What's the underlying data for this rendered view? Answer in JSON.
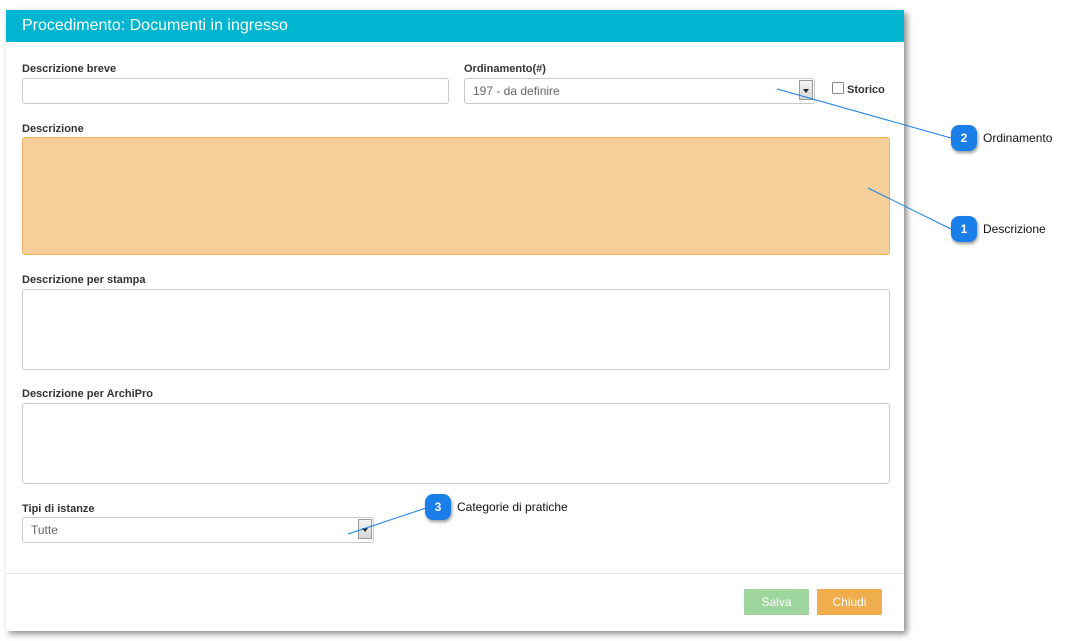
{
  "dialog": {
    "title": "Procedimento: Documenti in ingresso",
    "header_color": "#00b5cf"
  },
  "form": {
    "short_description": {
      "label": "Descrizione breve",
      "value": "",
      "placeholder": ""
    },
    "ordering": {
      "label": "Ordinamento(#)",
      "value": "197 - da definire"
    },
    "historical": {
      "label": "Storico",
      "checked": false
    },
    "description": {
      "label": "Descrizione",
      "value": "",
      "highlight_color": "#f5d09b"
    },
    "print_description": {
      "label": "Descrizione per stampa",
      "value": ""
    },
    "archipro_description": {
      "label": "Descrizione per ArchiPro",
      "value": ""
    },
    "request_types": {
      "label": "Tipi di istanze",
      "value": "Tutte"
    }
  },
  "footer": {
    "save_label": "Salva",
    "close_label": "Chiudi",
    "save_color": "#9ed69e",
    "close_color": "#f0ad4e"
  },
  "callouts": [
    {
      "number": "1",
      "label": "Descrizione"
    },
    {
      "number": "2",
      "label": "Ordinamento"
    },
    {
      "number": "3",
      "label": "Categorie di pratiche"
    }
  ],
  "callout_color": "#1a7fe8"
}
